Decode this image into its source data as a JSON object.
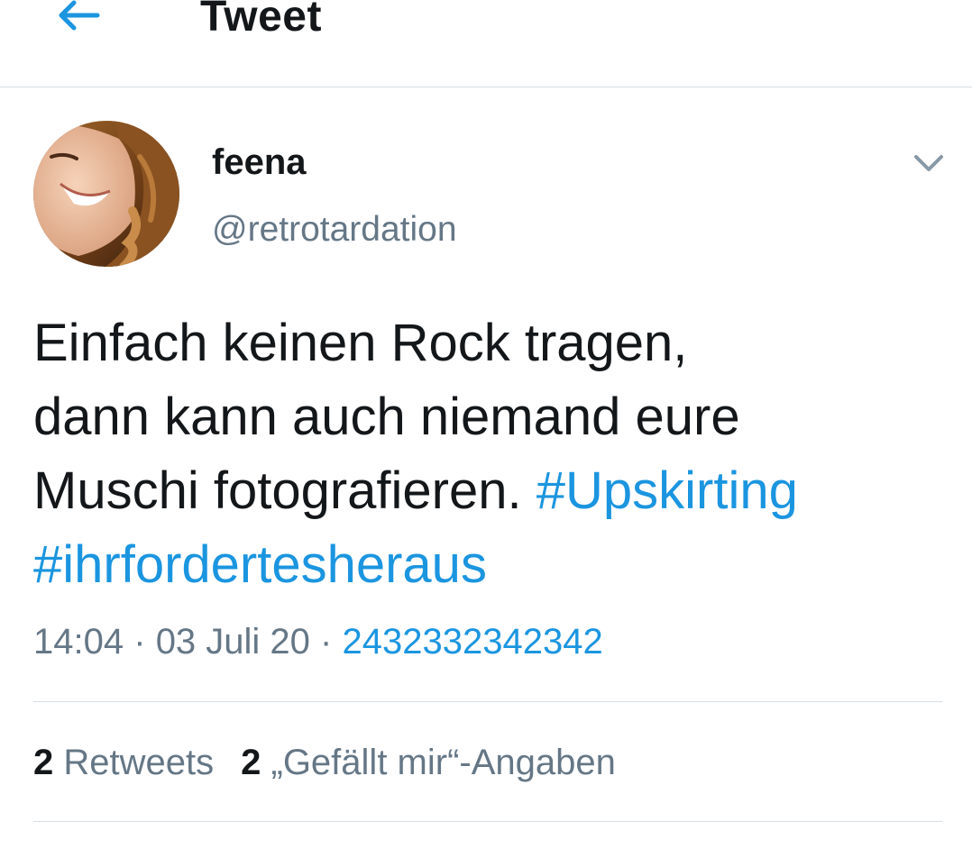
{
  "header": {
    "title": "Tweet",
    "back_icon": "arrow-left-icon",
    "accent_color": "#1b95e0"
  },
  "tweet": {
    "author": {
      "display_name": "feena",
      "handle": "@retrotardation"
    },
    "menu_icon": "chevron-down-icon",
    "text_parts": {
      "line1": "Einfach keinen Rock tragen,",
      "line2": "dann kann auch niemand eure",
      "line3": "Muschi fotografieren.",
      "hashtag1": "#Upskirting",
      "hashtag2": "#ihrfordertesheraus"
    },
    "meta": {
      "time": "14:04",
      "date": "03 Juli 20",
      "separator": "·",
      "source": "2432332342342"
    },
    "stats": {
      "retweets_count": "2",
      "retweets_label": "Retweets",
      "likes_count": "2",
      "likes_label": "„Gefällt mir“-Angaben"
    }
  },
  "colors": {
    "text": "#14171a",
    "secondary": "#657786",
    "link": "#1b95e0",
    "divider": "#d6dee4"
  }
}
